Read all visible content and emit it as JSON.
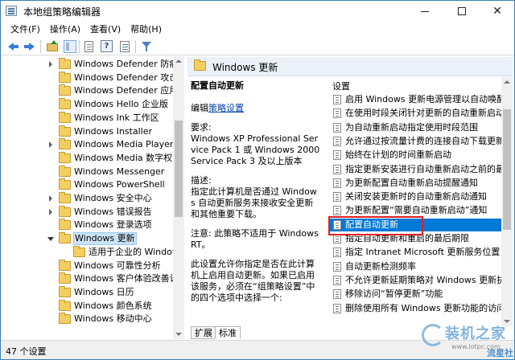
{
  "window": {
    "title": "本地组策略编辑器",
    "controls": {
      "minimize_icon": "minimize-icon",
      "maximize_icon": "maximize-icon",
      "close_label": "✕"
    }
  },
  "menu": [
    "文件(F)",
    "操作(A)",
    "查看(V)",
    "帮助(H)"
  ],
  "toolbar": {
    "icons": [
      "back-arrow-icon",
      "forward-arrow-icon",
      "up-folder-icon",
      "show-hide-tree-icon",
      "export-list-icon",
      "help-icon",
      "properties-icon",
      "filter-icon"
    ],
    "help_label": "?"
  },
  "tree": {
    "items": [
      {
        "label": "Windows Defender 防病毒",
        "expandable": true
      },
      {
        "label": "Windows Defender 攻击防护",
        "expandable": false
      },
      {
        "label": "Windows Defender 应用程序",
        "expandable": false
      },
      {
        "label": "Windows Hello 企业版",
        "expandable": false
      },
      {
        "label": "Windows Ink 工作区",
        "expandable": false
      },
      {
        "label": "Windows Installer",
        "expandable": false
      },
      {
        "label": "Windows Media Player",
        "expandable": true
      },
      {
        "label": "Windows Media 数字权限",
        "expandable": false
      },
      {
        "label": "Windows Messenger",
        "expandable": false
      },
      {
        "label": "Windows PowerShell",
        "expandable": false
      },
      {
        "label": "Windows 安全中心",
        "expandable": true
      },
      {
        "label": "Windows 错误报告",
        "expandable": true
      },
      {
        "label": "Windows 登录选项",
        "expandable": false
      },
      {
        "label": "Windows 更新",
        "expandable": true,
        "open": true,
        "selected": true
      },
      {
        "label": "适用于企业的 Windows",
        "expandable": false,
        "child": true
      },
      {
        "label": "Windows 可靠性分析",
        "expandable": false
      },
      {
        "label": "Windows 客户体验改善计划",
        "expandable": false
      },
      {
        "label": "Windows 日历",
        "expandable": false
      },
      {
        "label": "Windows 颜色系统",
        "expandable": false
      },
      {
        "label": "Windows 移动中心",
        "expandable": false
      }
    ]
  },
  "right_header": {
    "title": "Windows 更新"
  },
  "description": {
    "title": "配置自动更新",
    "edit_prefix": "编辑",
    "edit_link": "策略设置",
    "requirements_label": "要求:",
    "requirements_text": "Windows XP Professional Service Pack 1 或 Windows 2000 Service Pack 3 及以上版本",
    "desc_label": "描述:",
    "desc_text": "指定此计算机是否通过 Windows 自动更新服务来接收安全更新和其他重要下载。",
    "note": "注意: 此策略不适用于 Windows RT。",
    "extra": "此设置允许你指定是否在此计算机上启用自动更新。如果已启用该服务，必须在“组策略设置”中的四个选项中选择一个:"
  },
  "settings": {
    "header": "设置",
    "items": [
      "启用 Windows 更新电源管理以自动唤醒系统",
      "在使用时段关闭针对更新的自动重新启动",
      "为自动重新启动指定使用时段范围",
      "允许通过按流量计费的连接自动下载更新",
      "始终在计划的时间重新启动",
      "指定更新安装进行自动重新启动之前的最后期限",
      "为更新配置自动重新启动提醒通知",
      "关闭安装更新时的自动重新启动通知",
      "为更新配置“需要自动重新启动”通知",
      "配置自动更新",
      "指定自动更新和重启的最后期限",
      "指定 Intranet Microsoft 更新服务位置",
      "自动更新检测频率",
      "不允许更新延期策略对 Windows 更新执行扫描",
      "移除访问“暂停更新”功能",
      "删除使用所有 Windows 更新功能的访问权限"
    ],
    "selected_index": 9
  },
  "tabs": [
    "扩展",
    "标准"
  ],
  "status": {
    "text": "47 个设置"
  },
  "watermark": {
    "brand": "装机之家",
    "url": "www.lotpc.com",
    "corner": "流星社区"
  },
  "colors": {
    "selection": "#0078d7",
    "highlight_box": "#e02020",
    "link": "#0645ad"
  }
}
